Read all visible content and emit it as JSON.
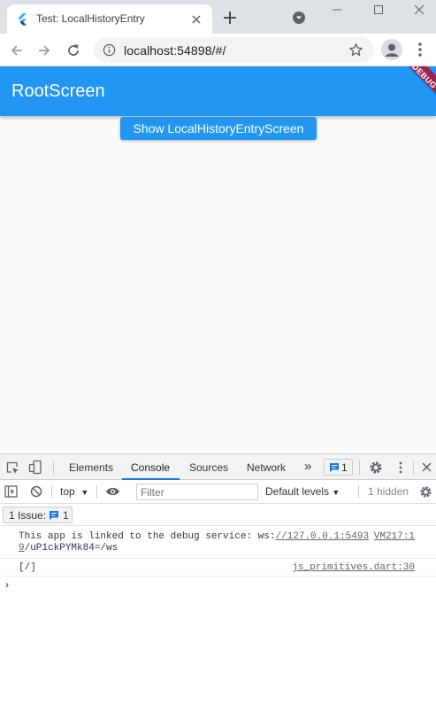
{
  "browser": {
    "tab_title": "Test: LocalHistoryEntry",
    "url": "localhost:54898/#/"
  },
  "app": {
    "title": "RootScreen",
    "debug_banner": "DEBUG",
    "button_label": "Show LocalHistoryEntryScreen",
    "colors": {
      "primary": "#2196f3",
      "background": "#fafafa",
      "banner": "#a0224a"
    }
  },
  "devtools": {
    "tabs": [
      "Elements",
      "Console",
      "Sources",
      "Network"
    ],
    "more_tabs": "»",
    "issues_badge_count": "1",
    "context": "top",
    "filter_placeholder": "Filter",
    "levels": "Default levels",
    "hidden": "1 hidden",
    "issues_label": "1 Issue:",
    "issues_count": "1",
    "messages": [
      {
        "text_prefix": "This app is linked to the debug service: ws:",
        "link_1": "//127.0.0.1:5493",
        "link_2": "9",
        "text_suffix": "/uP1ckPYMk84=/ws",
        "source": "VM217:1"
      },
      {
        "text": "[/]",
        "source": "js_primitives.dart:30"
      }
    ],
    "prompt": "›"
  }
}
